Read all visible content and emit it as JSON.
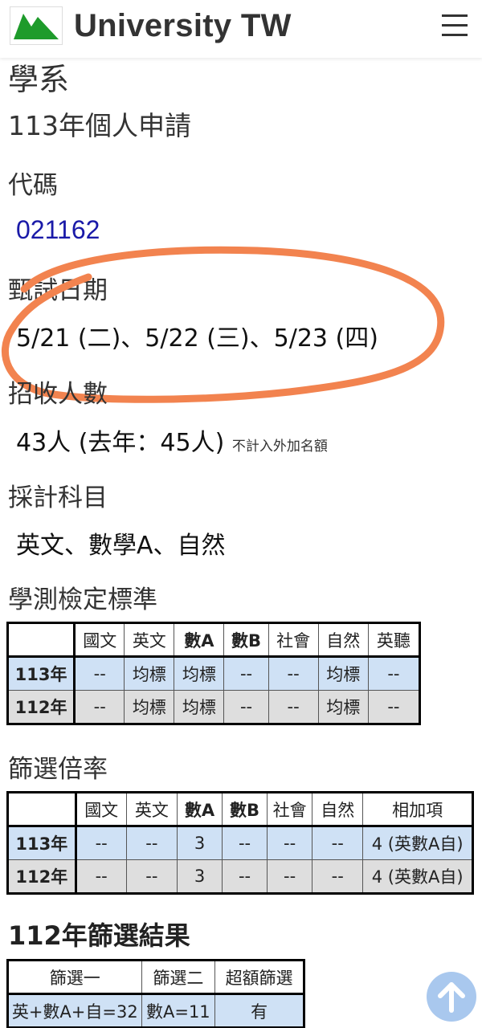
{
  "header": {
    "brand": "University TW",
    "logo_icon": "mountain-logo-icon",
    "menu_icon": "hamburger-menu-icon"
  },
  "page": {
    "dept_heading": "學系",
    "subtitle": "113年個人申請",
    "code_label": "代碼",
    "code_value": "021162",
    "exam_date_label": "甄試日期",
    "exam_date_value": "5/21 (二)、5/22 (三)、5/23 (四)",
    "quota_label": "招收人數",
    "quota_value": "43人 (去年：45人)",
    "quota_note": "不計入外加名額",
    "subjects_label": "採計科目",
    "subjects_value": "英文、數學A、自然",
    "gsat_label": "學測檢定標準",
    "screen_label": "篩選倍率",
    "result_label": "112年篩選結果"
  },
  "gsat_table": {
    "headers": [
      "",
      "國文",
      "英文",
      "數A",
      "數B",
      "社會",
      "自然",
      "英聽"
    ],
    "rows": [
      [
        "113年",
        "--",
        "均標",
        "均標",
        "--",
        "--",
        "均標",
        "--"
      ],
      [
        "112年",
        "--",
        "均標",
        "均標",
        "--",
        "--",
        "均標",
        "--"
      ]
    ]
  },
  "screen_table": {
    "headers": [
      "",
      "國文",
      "英文",
      "數A",
      "數B",
      "社會",
      "自然",
      "相加項"
    ],
    "rows": [
      [
        "113年",
        "--",
        "--",
        "3",
        "--",
        "--",
        "--",
        "4 (英數A自)"
      ],
      [
        "112年",
        "--",
        "--",
        "3",
        "--",
        "--",
        "--",
        "4 (英數A自)"
      ]
    ]
  },
  "result_table": {
    "headers": [
      "篩選一",
      "篩選二",
      "超額篩選"
    ],
    "rows": [
      [
        "英+數A+自=32",
        "數A=11",
        "有"
      ]
    ]
  },
  "fab": {
    "icon": "arrow-up-icon"
  },
  "colors": {
    "row_blue": "#cfe1f5",
    "row_gray": "#dedede",
    "annotation": "#f2834f",
    "link": "#1a1aa8"
  }
}
